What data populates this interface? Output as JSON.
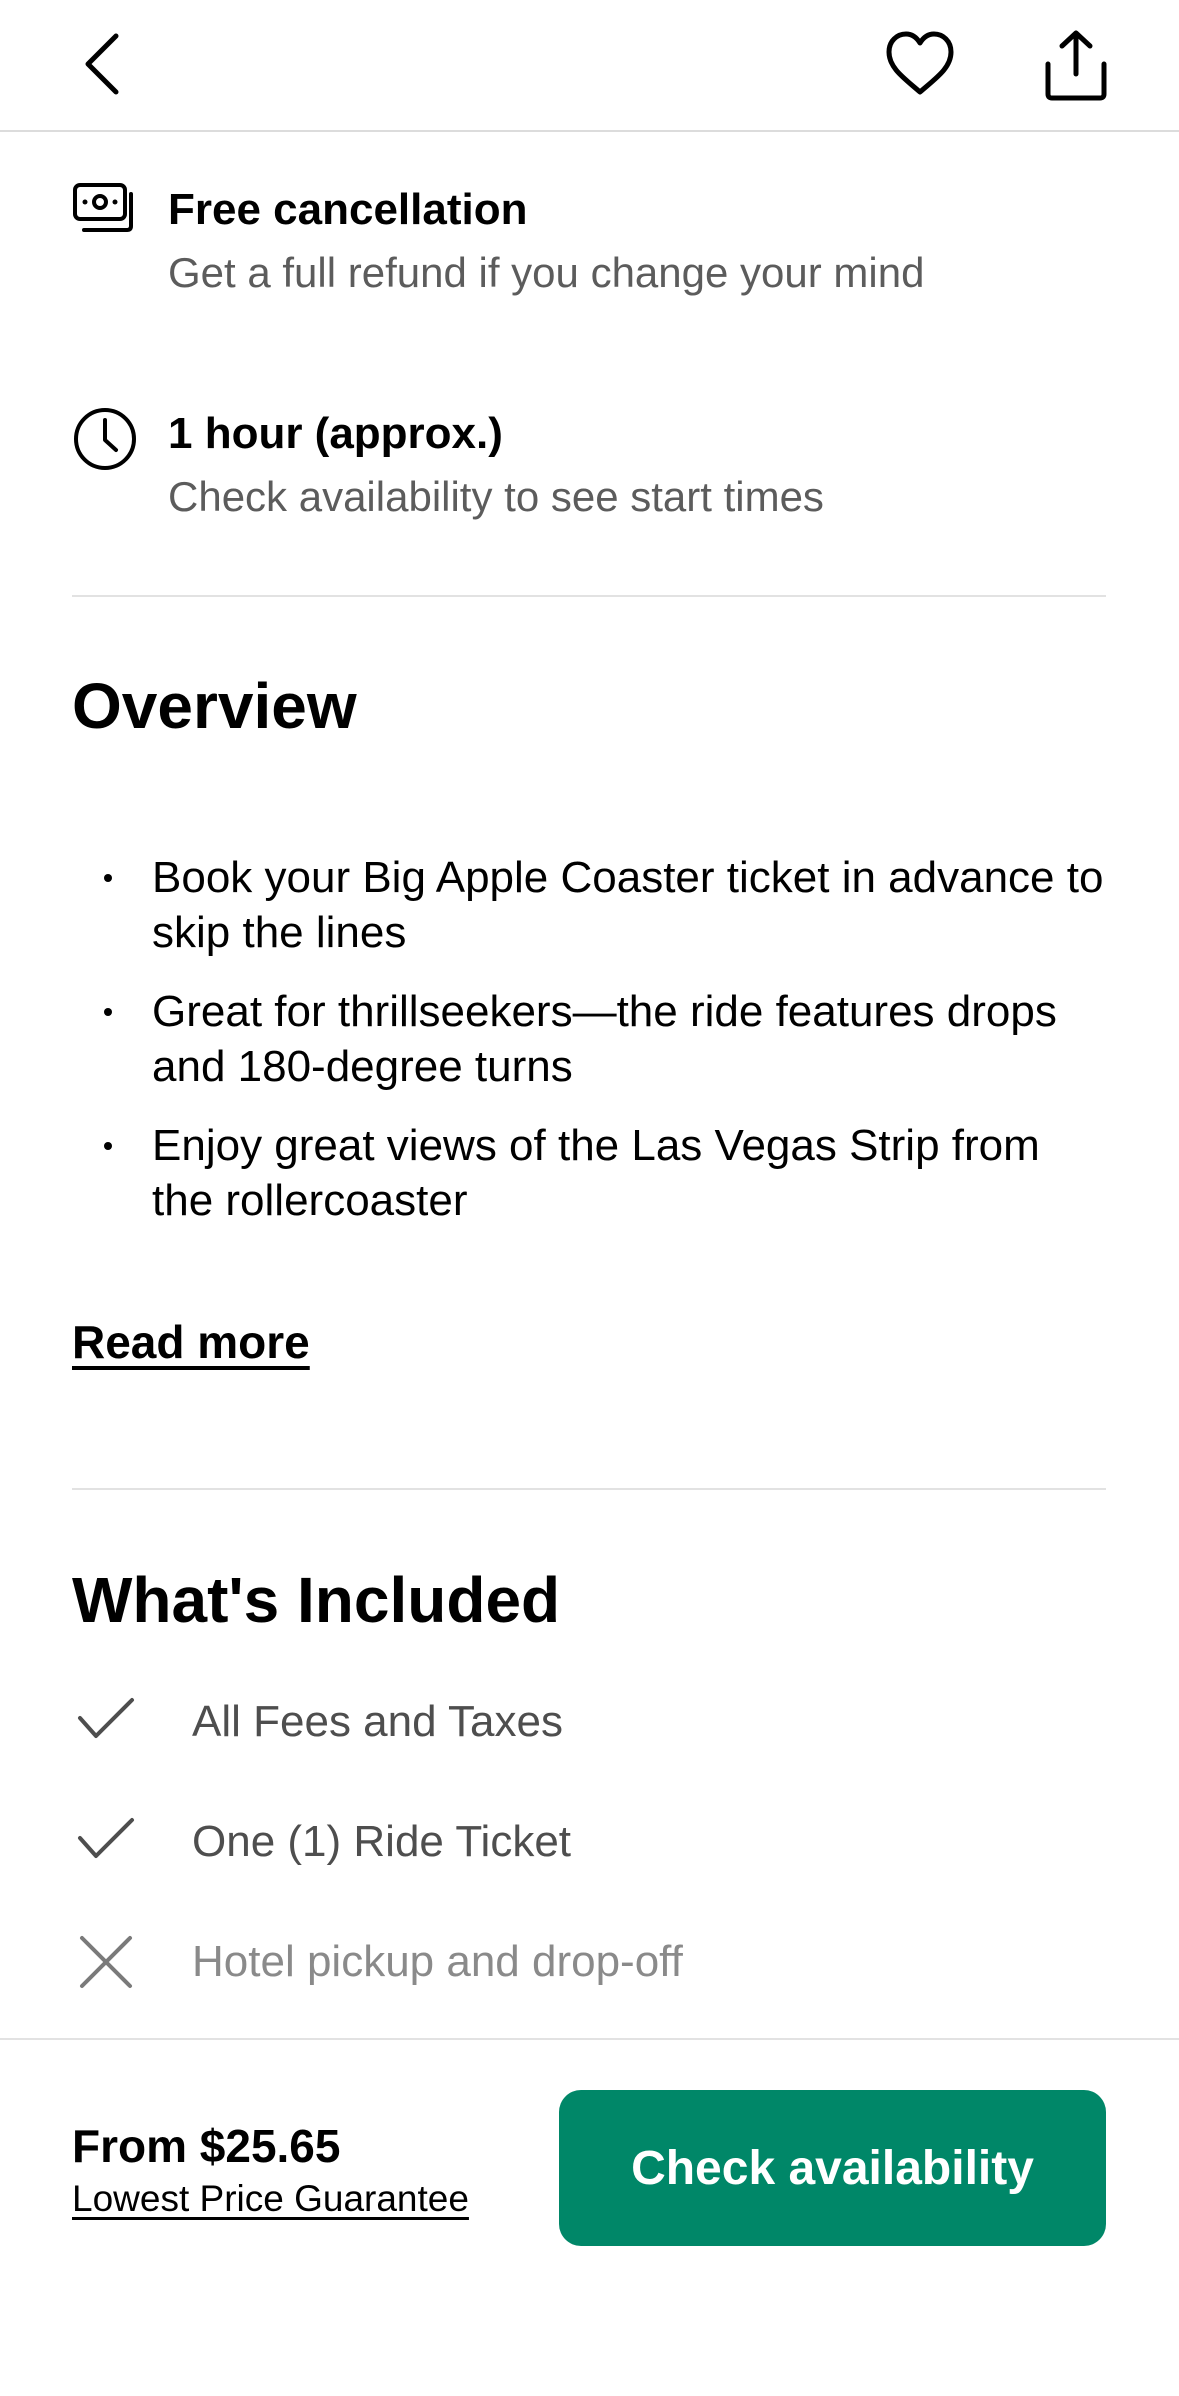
{
  "header": {
    "back_icon": "chevron-left-icon",
    "favorite_icon": "heart-outline-icon",
    "share_icon": "share-upload-icon"
  },
  "features": [
    {
      "icon": "cash-refund-icon",
      "title": "Free cancellation",
      "subtitle": "Get a full refund if you change your mind"
    },
    {
      "icon": "clock-icon",
      "title": "1 hour (approx.)",
      "subtitle": "Check availability to see start times"
    }
  ],
  "overview": {
    "title": "Overview",
    "bullets": [
      "Book your Big Apple Coaster ticket in advance to skip the lines",
      "Great for thrillseekers—the ride features drops and 180-degree turns",
      "Enjoy great views of the Las Vegas Strip from the rollercoaster"
    ],
    "read_more_label": "Read more"
  },
  "included": {
    "title": "What's Included",
    "items": [
      {
        "label": "All Fees and Taxes",
        "included": true,
        "icon": "checkmark-icon"
      },
      {
        "label": "One (1) Ride Ticket",
        "included": true,
        "icon": "checkmark-icon"
      },
      {
        "label": "Hotel pickup and drop-off",
        "included": false,
        "icon": "x-mark-icon"
      }
    ]
  },
  "footer": {
    "price_text": "From $25.65",
    "guarantee_label": "Lowest Price Guarantee",
    "cta_label": "Check availability"
  },
  "colors": {
    "accent": "#008768",
    "text_primary": "#000000",
    "text_secondary": "#5c5c5c",
    "divider": "#e2e2e2"
  }
}
